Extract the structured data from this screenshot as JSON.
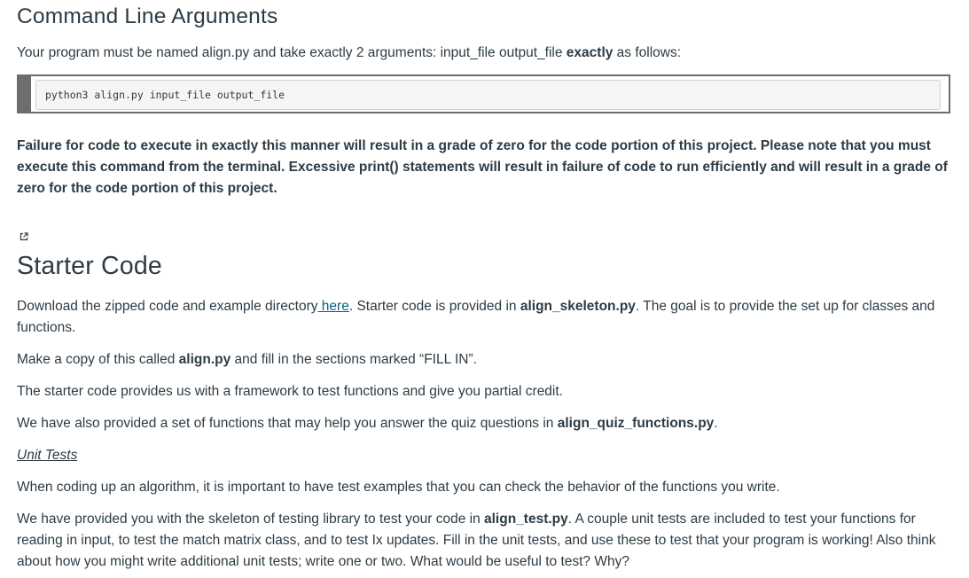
{
  "cla": {
    "heading": "Command Line Arguments",
    "intro_before": "Your program must be named align.py and take exactly 2 arguments: input_file output_file ",
    "intro_bold": "exactly",
    "intro_after": " as follows:",
    "command": "python3 align.py input_file output_file",
    "warning": "Failure for code to execute in exactly this manner will result in a grade of zero for the code portion of this project. Please note that you must execute this command from the terminal. Excessive print() statements will result in failure of code to run efficiently and will result in a grade of zero for the code portion of this project."
  },
  "icons": {
    "external_link": "external-link-icon"
  },
  "starter": {
    "heading": "Starter Code",
    "download_before": "Download the zipped code and example directory",
    "download_link": " here",
    "download_middle": ". Starter code is provided in ",
    "download_file": "align_skeleton.py",
    "download_after": ". The goal is to provide the set up for classes and functions.",
    "copy_before": "Make a copy of this called ",
    "copy_file": "align.py",
    "copy_after": " and fill in the sections marked “FILL IN”.",
    "framework": "The starter code provides us with a framework to test functions and give you partial credit.",
    "quiz_before": "We have also provided a set of functions that may help you answer the quiz questions in ",
    "quiz_file": "align_quiz_functions.py",
    "quiz_after": ".",
    "unit_tests_heading": "Unit Tests",
    "coding": "When coding up an algorithm, it is important to have test examples that you can check the behavior of the functions you write.",
    "skeleton_before": "We have provided you with the skeleton of testing library to test your code in ",
    "skeleton_file": "align_test.py",
    "skeleton_after": ". A couple unit tests are included to test your functions for reading in input, to test the match matrix class, and to test Ix updates. Fill in the unit tests, and use these to test that your program is working! Also think about how you might write additional unit tests; write one or two. What would be useful to test? Why?"
  },
  "colors": {
    "text": "#2d3b45",
    "link": "#0b5f7d",
    "code_border": "#6d6d6d",
    "code_bg": "#f5f5f5"
  }
}
